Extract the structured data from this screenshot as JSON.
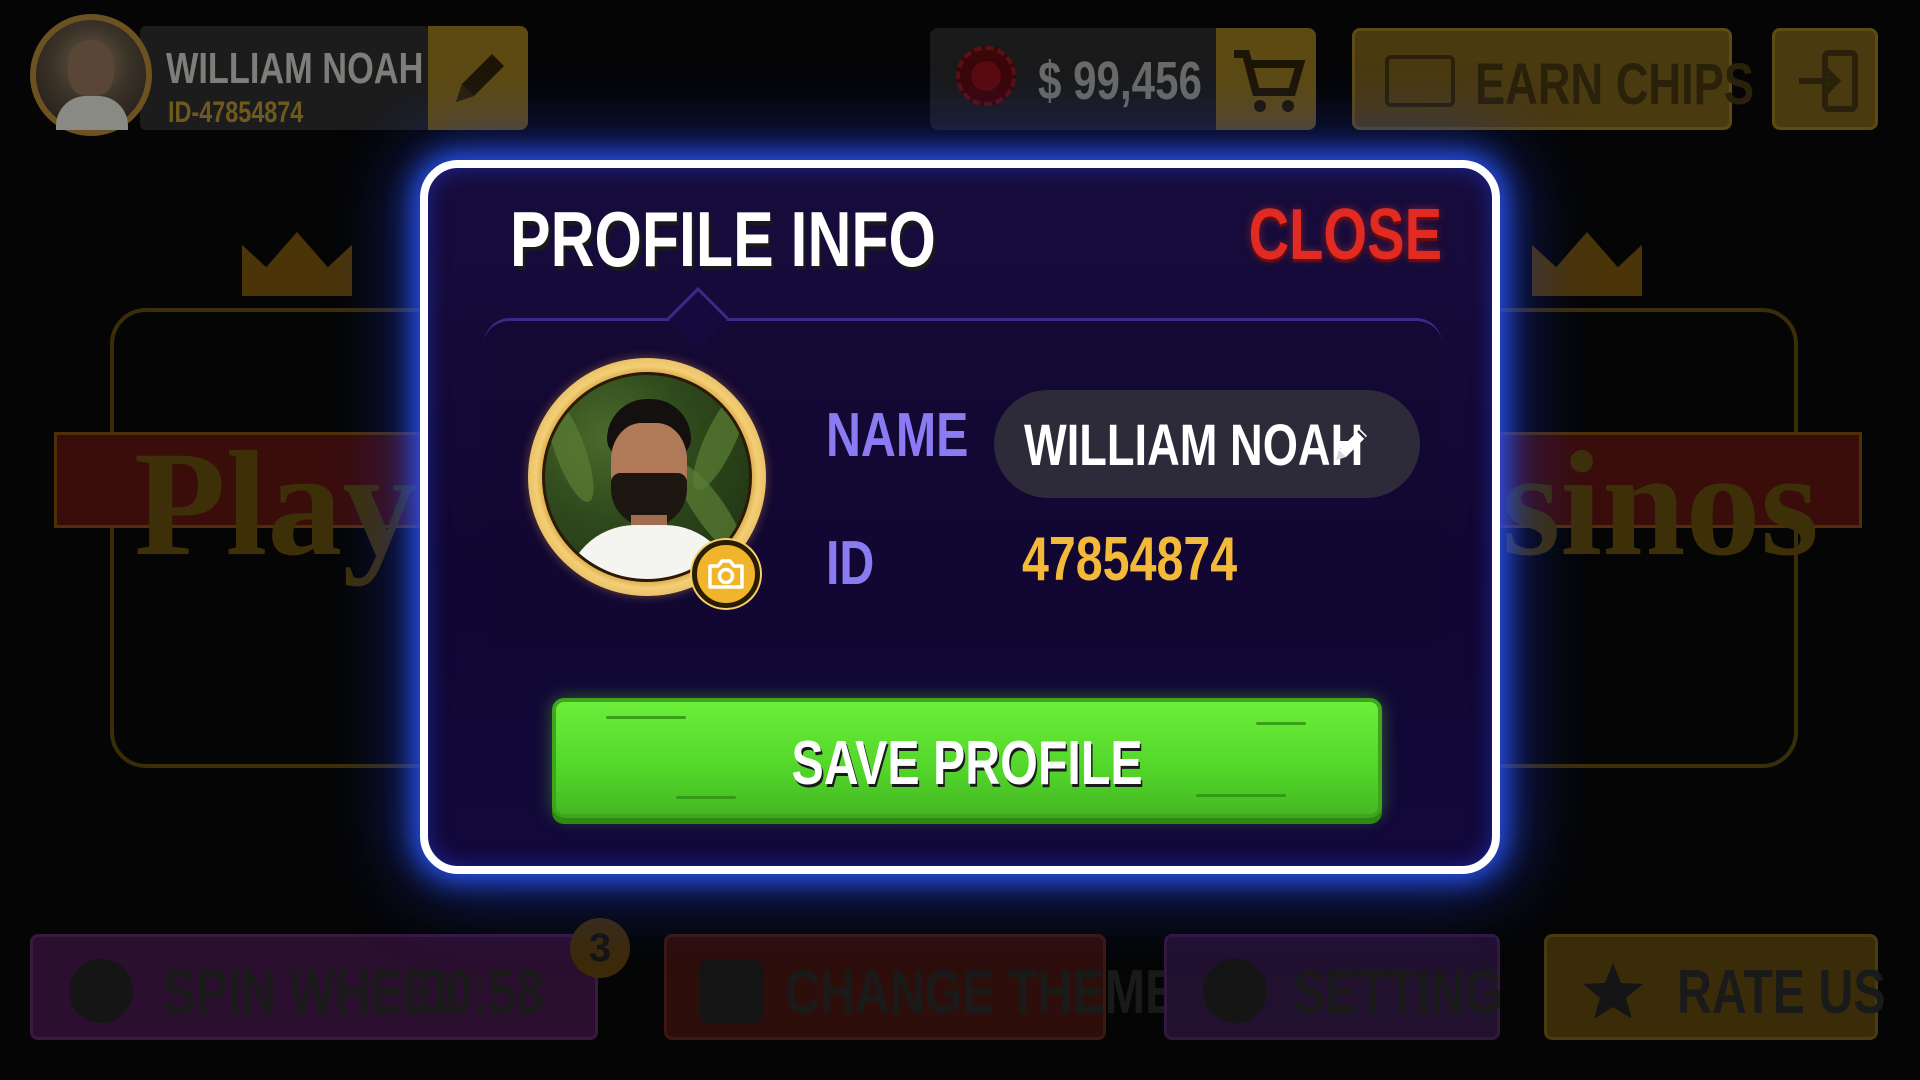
{
  "hud": {
    "player_name": "WILLIAM NOAH",
    "player_id": "ID-47854874",
    "chips_amount": "$ 99,456",
    "earn_chips_label": "EARN CHIPS"
  },
  "background": {
    "left_logo_text": "Play",
    "right_logo_text": "sinos"
  },
  "bottom_bar": {
    "spin_label": "SPIN WHEEL",
    "spin_timer": "00:58",
    "spin_badge": "3",
    "theme_label": "CHANGE THEME",
    "setting_label": "SETTING",
    "rate_label": "RATE US"
  },
  "modal": {
    "title": "PROFILE INFO",
    "close_label": "CLOSE",
    "name_label": "NAME",
    "name_value": "WILLIAM NOAH",
    "id_label": "ID",
    "id_value": "47854874",
    "save_label": "SAVE PROFILE"
  },
  "colors": {
    "modal_glow": "#2d5aff",
    "name_label": "#8b7bf3",
    "id_value": "#f5b93a",
    "close": "#e02a22",
    "save_button": "#52d62a"
  },
  "icons": [
    "edit-pencil-icon",
    "poker-chip-icon",
    "cart-icon",
    "clapperboard-icon",
    "exit-icon",
    "spin-wheel-icon",
    "paint-bucket-icon",
    "gear-icon",
    "star-icon",
    "camera-icon"
  ]
}
